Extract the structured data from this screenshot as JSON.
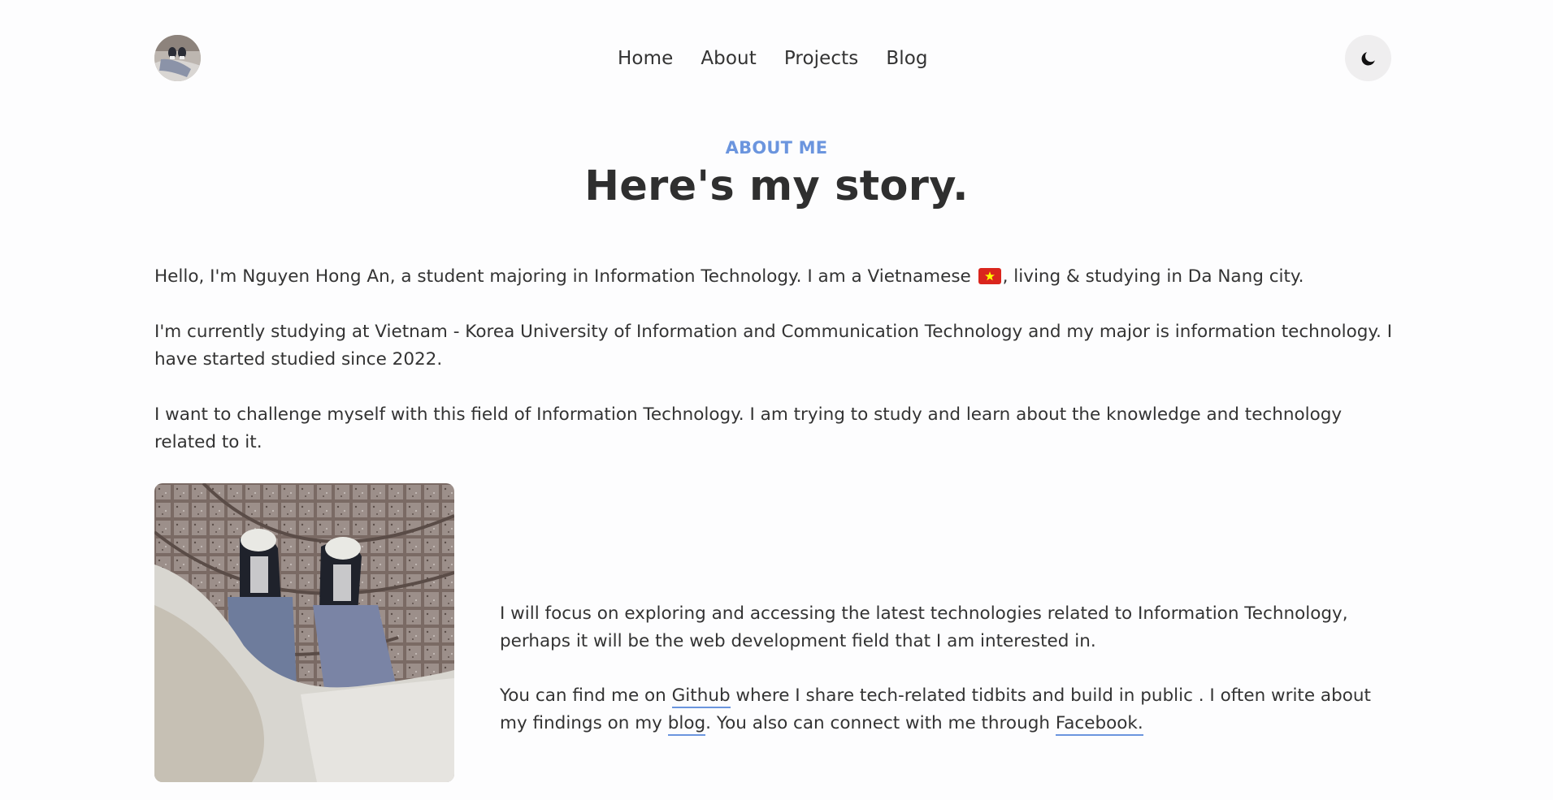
{
  "header": {
    "avatar_alt": "avatar",
    "nav": {
      "home": "Home",
      "about": "About",
      "projects": "Projects",
      "blog": "Blog"
    },
    "theme_icon": "moon-icon"
  },
  "section": {
    "eyebrow": "ABOUT ME",
    "title": "Here's my story."
  },
  "intro": {
    "p1_before_flag": "Hello, I'm Nguyen Hong An, a student majoring in Information Technology. I am a Vietnamese",
    "p1_after_flag": ", living & studying in Da Nang city.",
    "p2": "I'm currently studying at Vietnam - Korea University of Information and Communication Technology and my major is information technology. I have started studied since 2022.",
    "p3": "I want to challenge myself with this field of Information Technology. I am trying to study and learn about the knowledge and technology related to it."
  },
  "details": {
    "p4": "I will focus on exploring and accessing the latest technologies related to Information Technology, perhaps it will be the web development field that I am interested in.",
    "p5_part1": "You can find me on ",
    "github_link": "Github",
    "p5_part2": " where I share tech-related tidbits and build in public . I often write about my findings on my ",
    "blog_link": "blog",
    "p5_part3": ". You also can connect with me through ",
    "facebook_link": "Facebook."
  },
  "colors": {
    "accent": "#6b95de",
    "text": "#333333",
    "background": "#fdfdfe",
    "toggle_bg": "#efeeef",
    "flag_red": "#da251d",
    "flag_star": "#ffff00"
  }
}
